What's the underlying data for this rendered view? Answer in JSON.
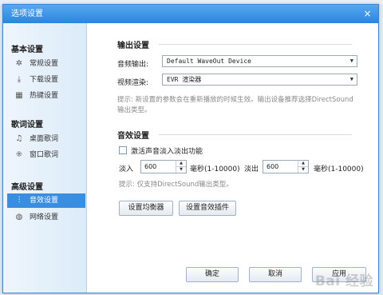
{
  "dialog": {
    "title": "选项设置",
    "close_glyph": "×"
  },
  "sidebar": {
    "groups": [
      {
        "title": "基本设置",
        "items": [
          {
            "label": "常规设置",
            "icon": "gear-icon"
          },
          {
            "label": "下载设置",
            "icon": "download-icon"
          },
          {
            "label": "热键设置",
            "icon": "keyboard-icon"
          }
        ]
      },
      {
        "title": "歌词设置",
        "items": [
          {
            "label": "桌面歌词",
            "icon": "desktop-lyrics-icon"
          },
          {
            "label": "窗口歌词",
            "icon": "window-lyrics-icon"
          }
        ]
      },
      {
        "title": "高级设置",
        "items": [
          {
            "label": "音效设置",
            "icon": "equalizer-icon",
            "active": true
          },
          {
            "label": "网络设置",
            "icon": "globe-icon"
          }
        ]
      }
    ]
  },
  "output": {
    "section_title": "输出设置",
    "audio_out_label": "音频输出:",
    "audio_out_value": "Default WaveOut Device",
    "video_render_label": "视频渲染:",
    "video_render_value": "EVR 渲染器",
    "hint_line1": "提示: 新设置的参数会在重新播放的时候生效。输出设备推荐选择DirectSound",
    "hint_line2": "输出类型。"
  },
  "effects": {
    "section_title": "音效设置",
    "fade_label": "激活声音淡入淡出功能",
    "fade_checked": false,
    "fade_in_label": "淡入",
    "fade_in_value": "600",
    "fade_in_unit": "毫秒(1-10000)",
    "fade_out_label": "淡出",
    "fade_out_value": "600",
    "fade_out_unit": "毫秒(1-10000)",
    "hint": "提示: 仅支持DirectSound输出类型。",
    "eq_button": "设置均衡器",
    "plugin_button": "设置音效插件"
  },
  "footer": {
    "ok": "确定",
    "cancel": "取消",
    "apply": "应用"
  },
  "watermark": "Bai 经验",
  "colors": {
    "titlebar": "#2a86dc",
    "active_item": "#3a8ee0",
    "sidebar_bg": "#dcebf9"
  }
}
